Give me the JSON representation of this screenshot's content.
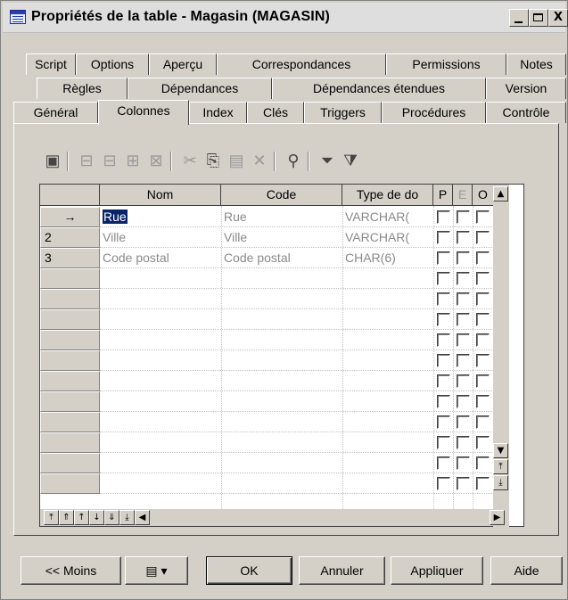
{
  "window": {
    "title": "Propriétés de la table - Magasin (MAGASIN)",
    "controls": {
      "minimize": "_",
      "maximize": "□",
      "close": "X"
    }
  },
  "tabs": {
    "row1": [
      "Script",
      "Options",
      "Aperçu",
      "Correspondances",
      "Permissions",
      "Notes"
    ],
    "row2": [
      "Règles",
      "Dépendances",
      "Dépendances étendues",
      "Version"
    ],
    "row3": [
      "Général",
      "Colonnes",
      "Index",
      "Clés",
      "Triggers",
      "Procédures",
      "Contrôle"
    ],
    "active": "Colonnes"
  },
  "toolbar": {
    "icons": [
      "properties-icon",
      "insert-row-icon",
      "add-row-icon",
      "add-rows-icon",
      "delete-row-icon",
      "cut-icon",
      "copy-icon",
      "paste-icon",
      "delete-icon",
      "find-icon",
      "filter-icon",
      "filter-options-icon"
    ]
  },
  "grid": {
    "columns": [
      "Nom",
      "Code",
      "Type de do",
      "P",
      "E",
      "O"
    ],
    "rows": [
      {
        "header": "→",
        "nom": "Rue",
        "code": "Rue",
        "type": "VARCHAR(",
        "selected": true
      },
      {
        "header": "2",
        "nom": "Ville",
        "code": "Ville",
        "type": "VARCHAR(",
        "selected": false
      },
      {
        "header": "3",
        "nom": "Code postal",
        "code": "Code postal",
        "type": "CHAR(6)",
        "selected": false
      }
    ],
    "empty_rows": 11,
    "nav_icons": [
      "move-top-icon",
      "move-up-page-icon",
      "move-up-icon",
      "move-down-icon",
      "move-down-page-icon",
      "move-bottom-icon",
      "scroll-left-icon",
      "scroll-right-icon"
    ]
  },
  "footer": {
    "less": "<< Moins",
    "ok": "OK",
    "cancel": "Annuler",
    "apply": "Appliquer",
    "help": "Aide"
  }
}
